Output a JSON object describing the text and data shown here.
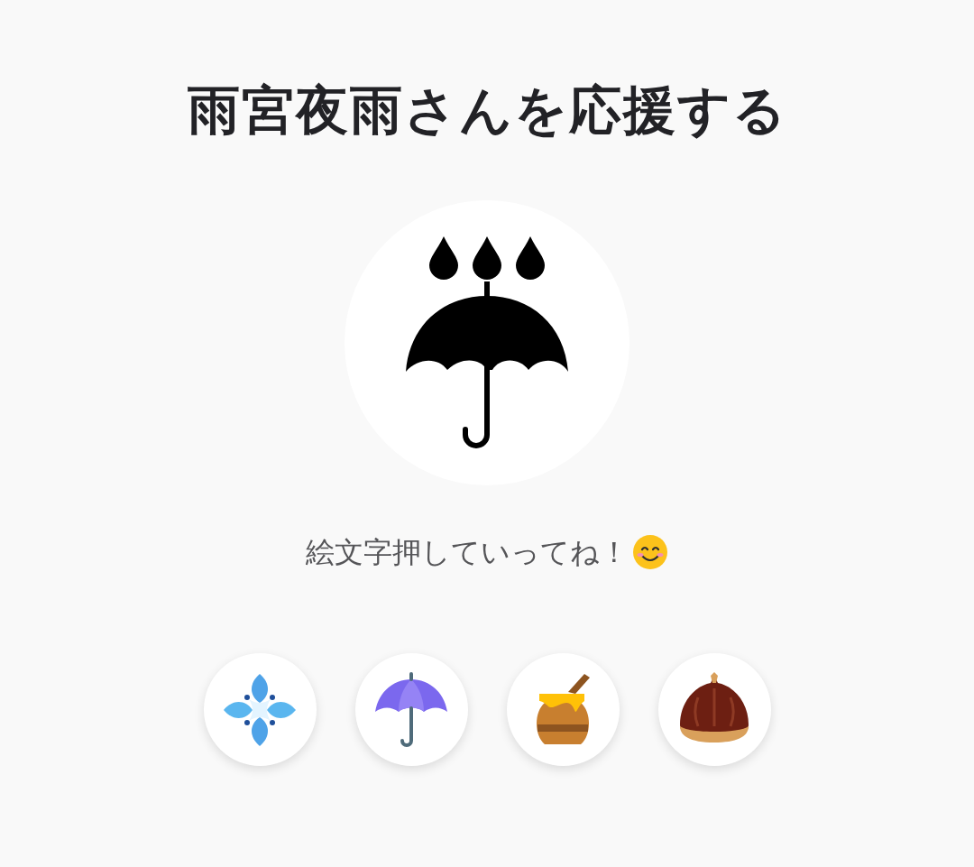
{
  "title": "雨宮夜雨さんを応援する",
  "avatar": {
    "kind": "umbrella-rain"
  },
  "message": "絵文字押していってね！",
  "message_emoji": {
    "kind": "smile"
  },
  "reactions": [
    {
      "kind": "flower"
    },
    {
      "kind": "umbrella"
    },
    {
      "kind": "honey"
    },
    {
      "kind": "chestnut"
    }
  ]
}
